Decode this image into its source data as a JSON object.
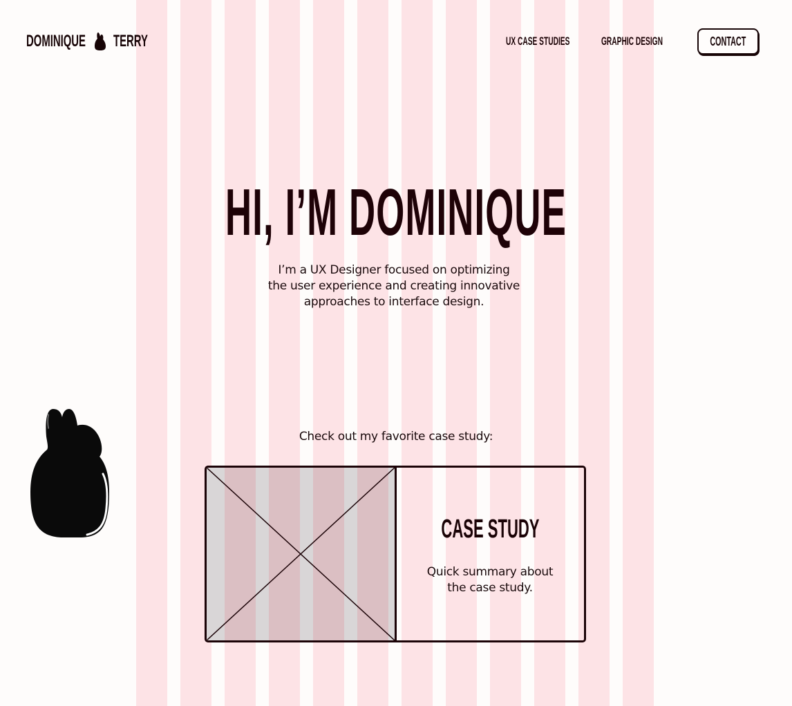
{
  "header": {
    "logo_first": "DOMINIQUE",
    "logo_last": "TERRY",
    "logo_icon": "bunny-icon",
    "nav": [
      {
        "label": "UX CASE STUDIES"
      },
      {
        "label": "GRAPHIC DESIGN"
      }
    ],
    "contact_label": "CONTACT"
  },
  "hero": {
    "title": "HI, I’M DOMINIQUE",
    "subtitle_lines": [
      "I’m a UX Designer focused on optimizing",
      "the user experience and creating innovative",
      "approaches to interface design."
    ]
  },
  "featured": {
    "label": "Check out my favorite case study:",
    "card": {
      "image_icon": "image-placeholder-icon",
      "title": "CASE STUDY",
      "summary_lines": [
        "Quick summary about",
        "the case study."
      ]
    }
  },
  "decoration": {
    "mascot_icon": "bunny-icon"
  },
  "colors": {
    "background": "#fefcfb",
    "grid_column": "#fde3e6",
    "ink": "#1a0306"
  }
}
